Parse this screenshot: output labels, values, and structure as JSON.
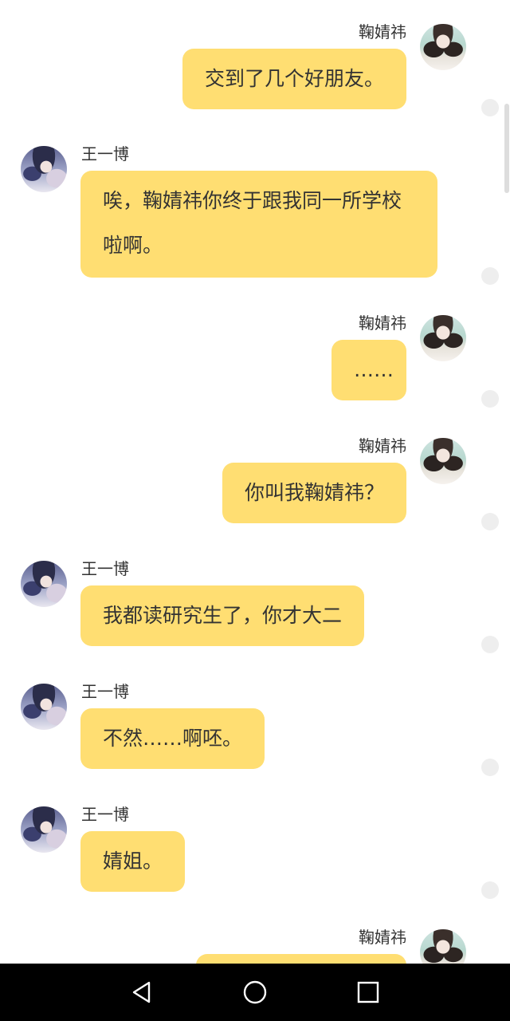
{
  "messages": [
    {
      "side": "right",
      "sender": "鞠婧祎",
      "text": "交到了几个好朋友。"
    },
    {
      "side": "left",
      "sender": "王一博",
      "text": "唉，鞠婧祎你终于跟我同一所学校啦啊。"
    },
    {
      "side": "right",
      "sender": "鞠婧祎",
      "text": "……"
    },
    {
      "side": "right",
      "sender": "鞠婧祎",
      "text": "你叫我鞠婧祎？"
    },
    {
      "side": "left",
      "sender": "王一博",
      "text": "我都读研究生了，你才大二"
    },
    {
      "side": "left",
      "sender": "王一博",
      "text": "不然……啊呸。"
    },
    {
      "side": "left",
      "sender": "王一博",
      "text": "婧姐。"
    },
    {
      "side": "right",
      "sender": "鞠婧祎",
      "text": ""
    }
  ],
  "navbar": {
    "back_icon": "back-triangle-icon",
    "home_icon": "home-circle-icon",
    "recents_icon": "recents-square-icon"
  },
  "colors": {
    "bubble": "#ffde72",
    "text": "#333333",
    "navbar": "#000000"
  }
}
